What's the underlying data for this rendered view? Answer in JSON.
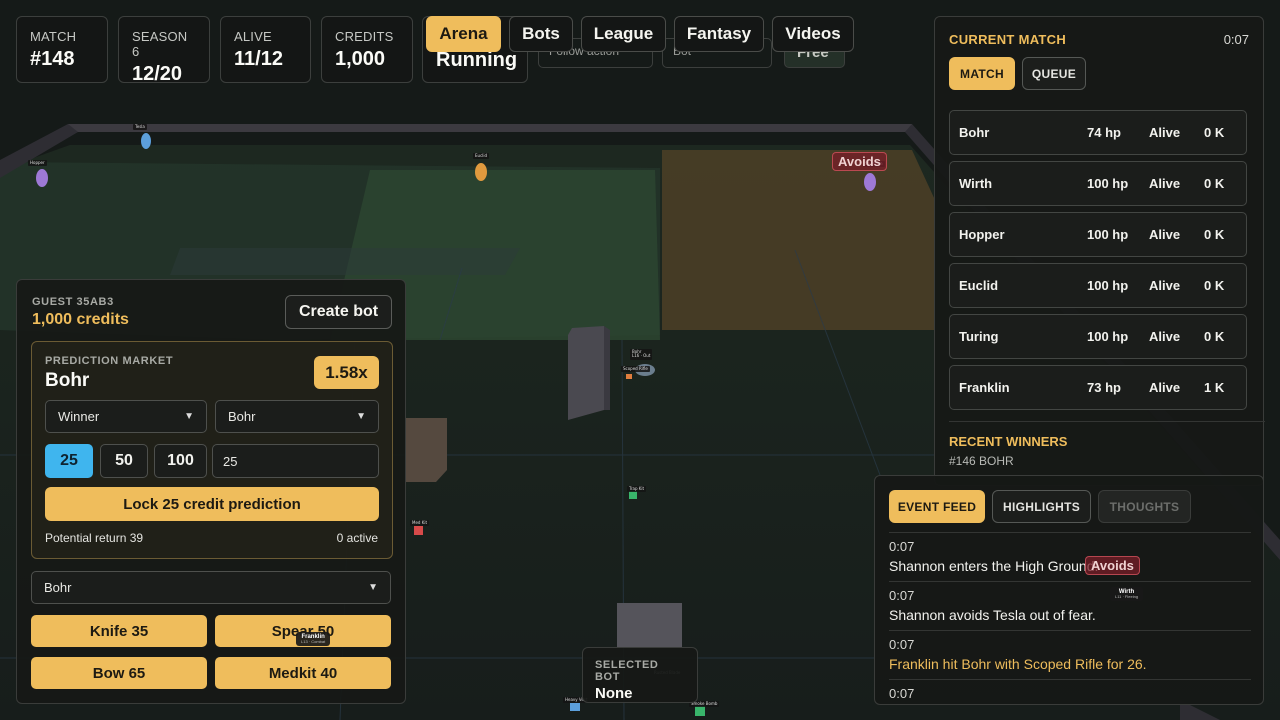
{
  "stats": [
    {
      "key": "MATCH",
      "value": "#148"
    },
    {
      "key": "SEASON 6",
      "value": "12/20"
    },
    {
      "key": "ALIVE",
      "value": "11/12"
    },
    {
      "key": "CREDITS",
      "value": "1,000"
    }
  ],
  "status_card": {
    "value": "Running"
  },
  "nav": [
    {
      "label": "Arena",
      "active": true
    },
    {
      "label": "Bots",
      "active": false
    },
    {
      "label": "League",
      "active": false
    },
    {
      "label": "Fantasy",
      "active": false
    },
    {
      "label": "Videos",
      "active": false
    }
  ],
  "hidden_controls": {
    "camera_select": "Follow action",
    "bot_select": "Bot",
    "free_button": "Free"
  },
  "arena": {
    "bubbles": [
      "Avoids",
      "Avoids"
    ],
    "nameplates": [
      {
        "name": "Franklin",
        "sub": "L13 · Combat"
      },
      {
        "name": "Wirth",
        "sub": "L11 · Fleeing"
      }
    ],
    "labels": [
      "Bohr",
      "L16 · Out",
      "Scoped Rifle",
      "Trap Kit",
      "Med Kit",
      "Heavy Vest",
      "Smoke Bomb",
      "Rusted Blade",
      "Shannon",
      "Tesla",
      "Euclid",
      "Hopper"
    ]
  },
  "account": {
    "guest_id": "GUEST 35AB3",
    "credits": "1,000 credits",
    "create_bot": "Create bot"
  },
  "market": {
    "label": "PREDICTION MARKET",
    "pick": "Bohr",
    "odds": "1.58x",
    "type_select": "Winner",
    "bot_select": "Bohr",
    "amounts": [
      "25",
      "50",
      "100"
    ],
    "active_amount_index": 0,
    "amount_input": "25",
    "lock_button": "Lock 25 credit prediction",
    "potential_return": "Potential return 39",
    "active_count": "0 active"
  },
  "shop": {
    "target_select": "Bohr",
    "items": [
      "Knife 35",
      "Spear 50",
      "Bow 65",
      "Medkit 40"
    ]
  },
  "current_match": {
    "title": "CURRENT MATCH",
    "time": "0:07",
    "tabs": [
      "MATCH",
      "QUEUE"
    ],
    "bots": [
      {
        "name": "Bohr",
        "hp": "74 hp",
        "status": "Alive",
        "kills": "0 K"
      },
      {
        "name": "Wirth",
        "hp": "100 hp",
        "status": "Alive",
        "kills": "0 K"
      },
      {
        "name": "Hopper",
        "hp": "100 hp",
        "status": "Alive",
        "kills": "0 K"
      },
      {
        "name": "Euclid",
        "hp": "100 hp",
        "status": "Alive",
        "kills": "0 K"
      },
      {
        "name": "Turing",
        "hp": "100 hp",
        "status": "Alive",
        "kills": "0 K"
      },
      {
        "name": "Franklin",
        "hp": "73 hp",
        "status": "Alive",
        "kills": "1 K"
      }
    ],
    "recent_winners_title": "RECENT WINNERS",
    "recent_winners": [
      "#146 BOHR"
    ]
  },
  "feed": {
    "tabs": [
      "EVENT FEED",
      "HIGHLIGHTS",
      "THOUGHTS"
    ],
    "events": [
      {
        "time": "0:07",
        "text": "Shannon enters the High Ground."
      },
      {
        "time": "0:07",
        "text": "Shannon avoids Tesla out of fear."
      },
      {
        "time": "0:07",
        "text": "Franklin hit Bohr with Scoped Rifle for 26."
      },
      {
        "time": "0:07",
        "text": ""
      }
    ]
  },
  "selected_bot": {
    "label": "SELECTED BOT",
    "value": "None"
  }
}
